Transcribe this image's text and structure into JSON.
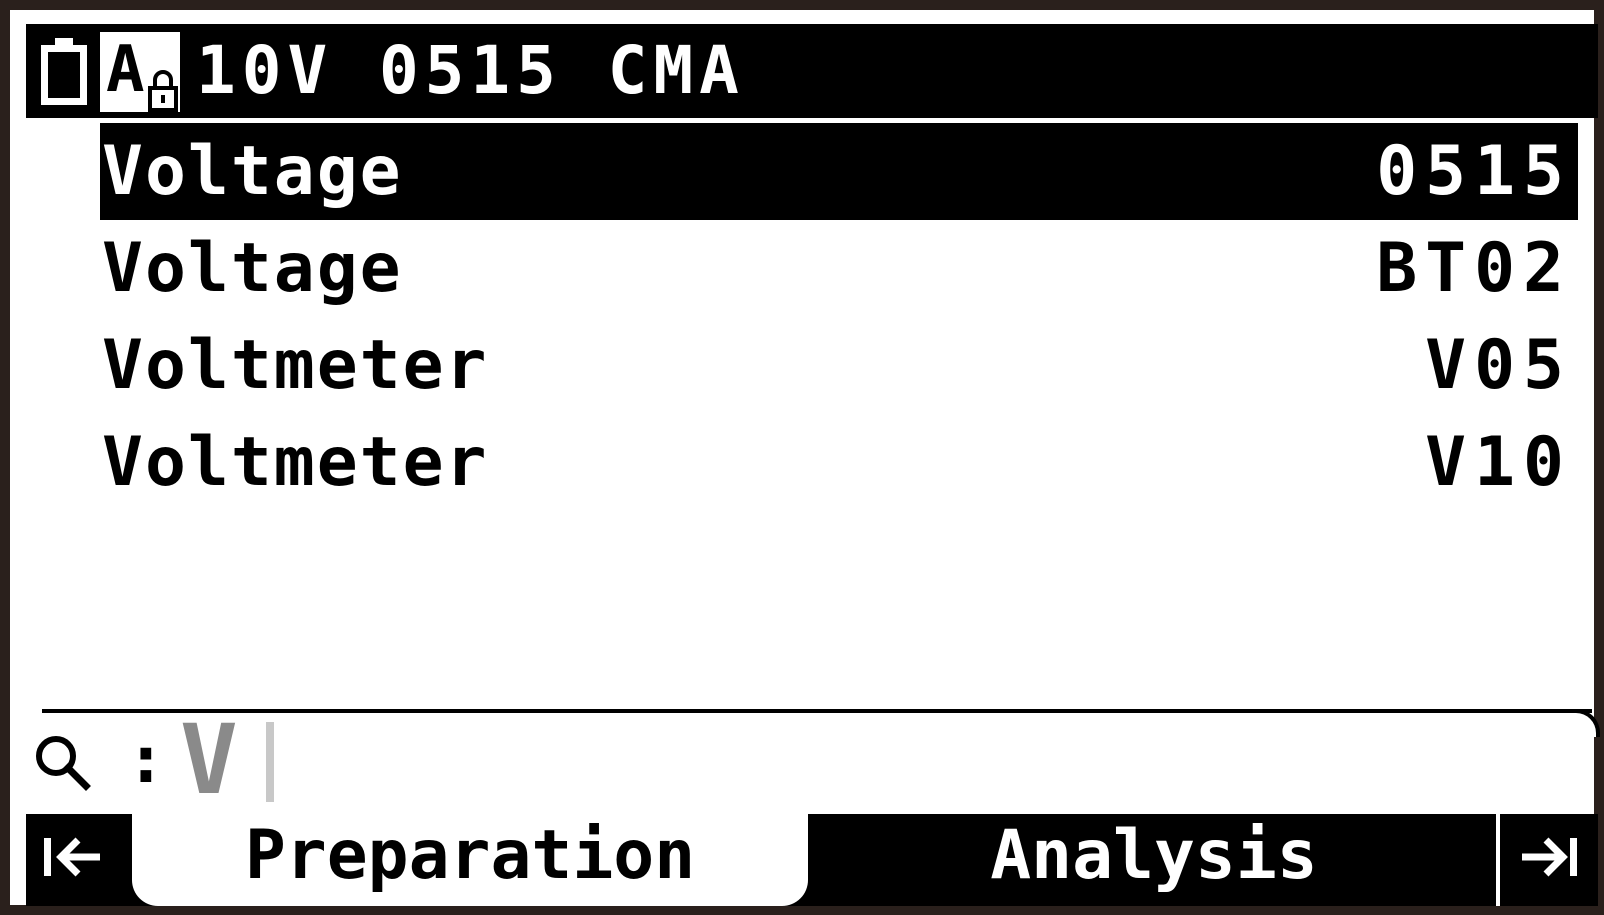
{
  "header": {
    "title": "10V 0515 CMA",
    "battery_icon": "battery-icon",
    "lock_icon": "keypad-lock-icon",
    "lock_letter": "A"
  },
  "list": {
    "items": [
      {
        "label": "Voltage",
        "code": "0515",
        "selected": true
      },
      {
        "label": "Voltage",
        "code": "BT02",
        "selected": false
      },
      {
        "label": "Voltmeter",
        "code": "V05",
        "selected": false
      },
      {
        "label": "Voltmeter",
        "code": "V10",
        "selected": false
      }
    ]
  },
  "search": {
    "icon": "search-icon",
    "separator": ":",
    "value": "V"
  },
  "tabs": {
    "left_icon": "first-page-icon",
    "preparation": "Preparation",
    "analysis": "Analysis",
    "right_icon": "last-page-icon"
  },
  "colors": {
    "frame": "#2a201c",
    "foreground": "#000000",
    "background": "#ffffff",
    "search_text": "#8a8a8a"
  }
}
